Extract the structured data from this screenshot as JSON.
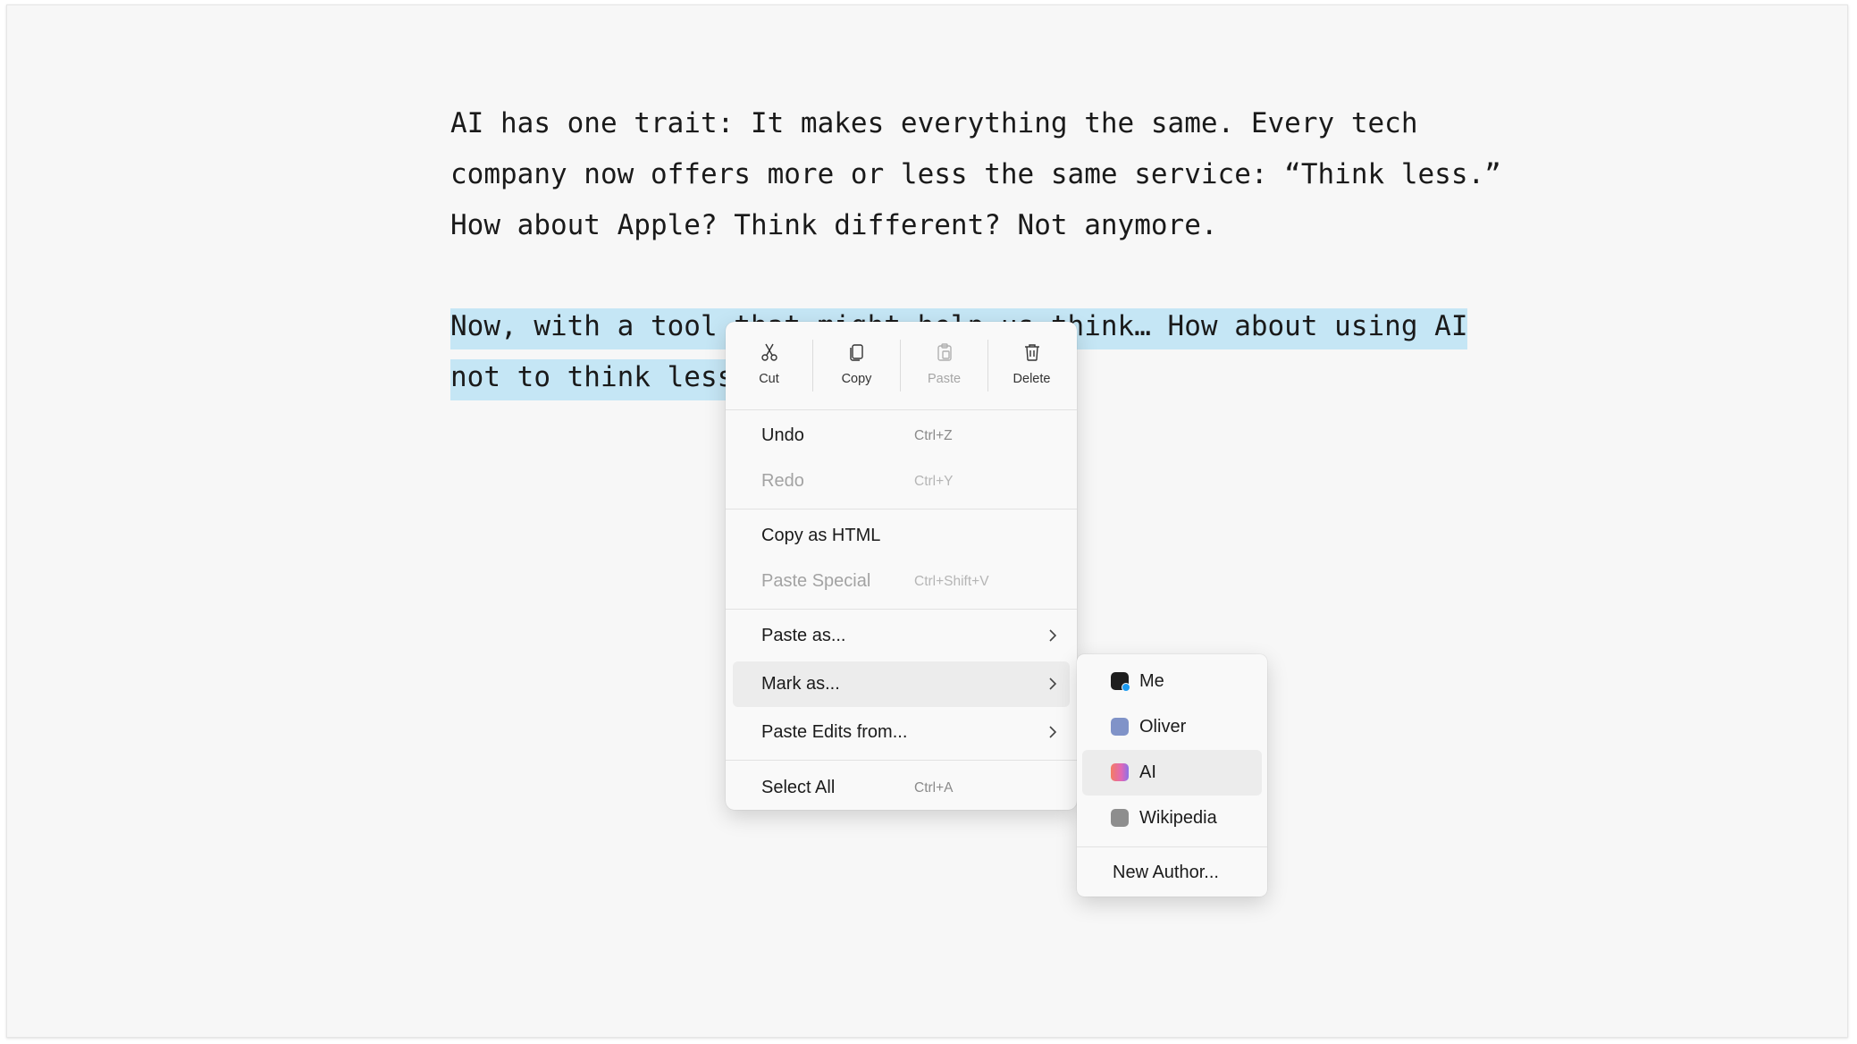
{
  "document": {
    "paragraph1": "AI has one trait: It makes everything the same. Every tech company now offers more or less the same service: “Think less.” How about Apple? Think different? Not anymore.",
    "paragraph2_line1": "Now, with a tool that might help us think… How about using AI",
    "paragraph2_line2": "not to think less"
  },
  "context_menu": {
    "toolbar": {
      "cut": "Cut",
      "copy": "Copy",
      "paste": "Paste",
      "delete": "Delete"
    },
    "items": {
      "undo": {
        "label": "Undo",
        "shortcut": "Ctrl+Z"
      },
      "redo": {
        "label": "Redo",
        "shortcut": "Ctrl+Y"
      },
      "copy_html": {
        "label": "Copy as HTML"
      },
      "paste_special": {
        "label": "Paste Special",
        "shortcut": "Ctrl+Shift+V"
      },
      "paste_as": {
        "label": "Paste as..."
      },
      "mark_as": {
        "label": "Mark as..."
      },
      "paste_edits": {
        "label": "Paste Edits from..."
      },
      "select_all": {
        "label": "Select All",
        "shortcut": "Ctrl+A"
      }
    }
  },
  "submenu": {
    "authors": [
      {
        "label": "Me",
        "color": "#1e1e1e"
      },
      {
        "label": "Oliver",
        "color": "#8093c8"
      },
      {
        "label": "AI",
        "color": "#e8708f"
      },
      {
        "label": "Wikipedia",
        "color": "#8e8e8e"
      }
    ],
    "new_author": "New Author..."
  },
  "colors": {
    "selection": "#c5e6f5",
    "background": "#f7f7f7",
    "menu": "#f9f9f9",
    "hover": "#ececec",
    "me_badge": "#1d9bf0"
  }
}
